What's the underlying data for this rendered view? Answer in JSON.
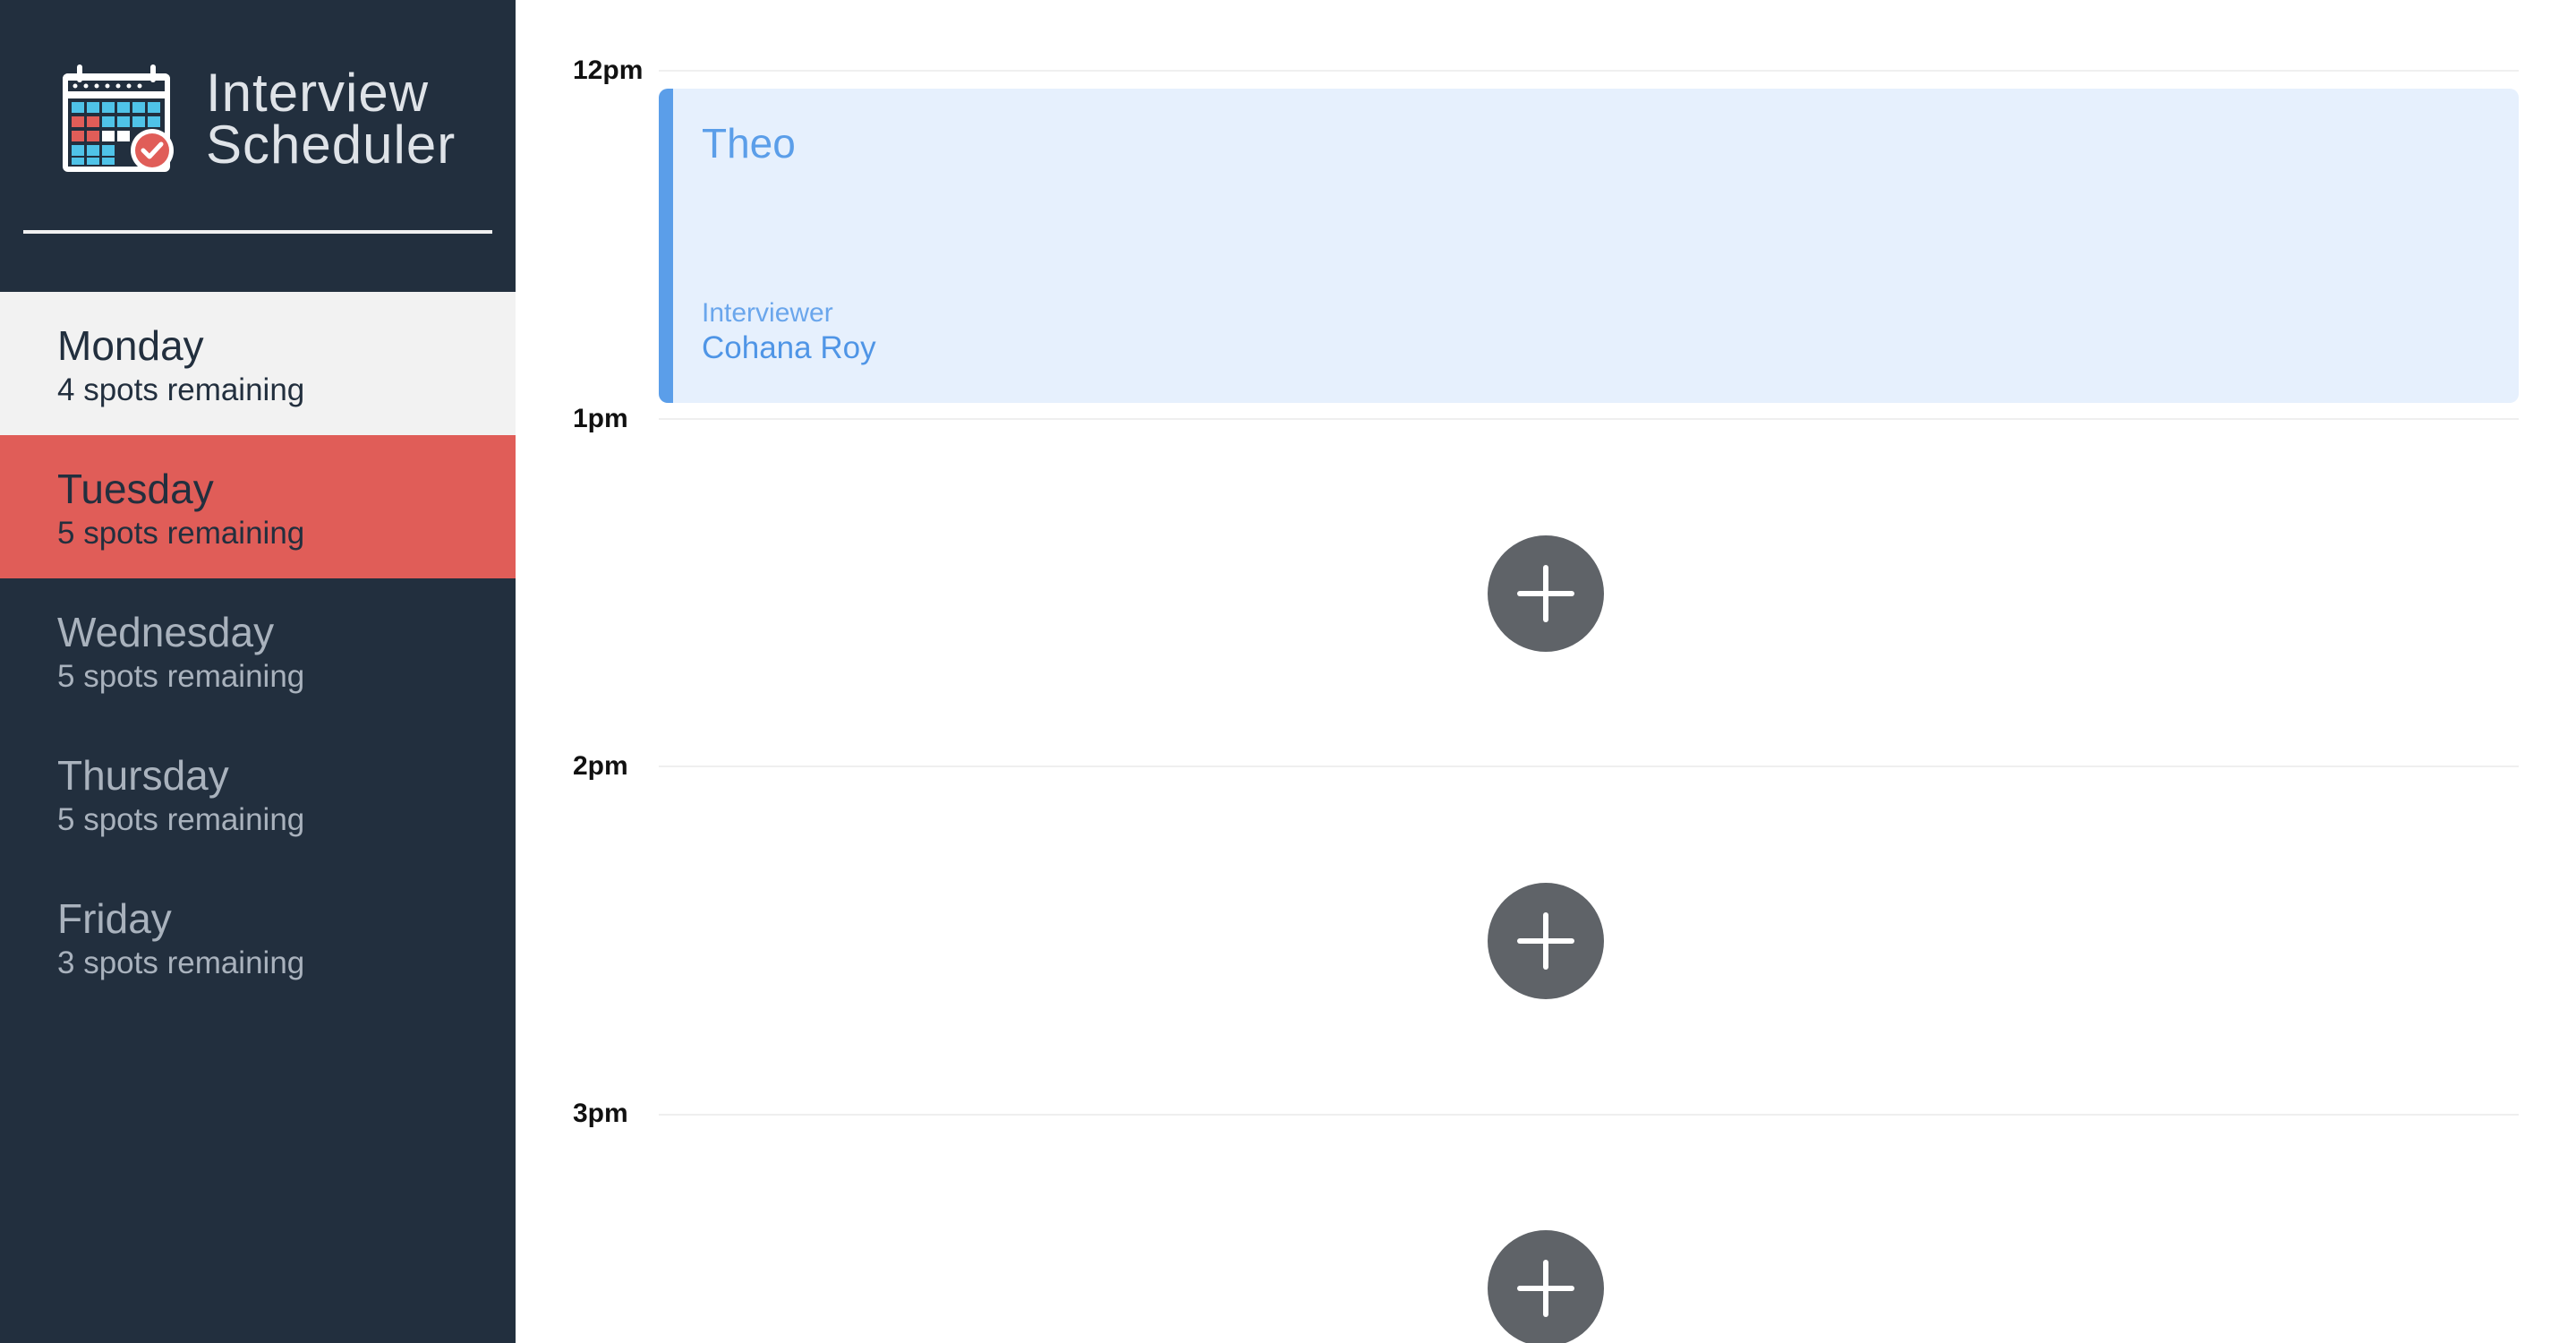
{
  "brand": {
    "title_line1": "Interview",
    "title_line2": "Scheduler",
    "icon": "calendar-check-icon"
  },
  "sidebar": {
    "days": [
      {
        "name": "Monday",
        "spots": "4 spots remaining",
        "state": "selected"
      },
      {
        "name": "Tuesday",
        "spots": "5 spots remaining",
        "state": "highlight"
      },
      {
        "name": "Wednesday",
        "spots": "5 spots remaining",
        "state": "normal"
      },
      {
        "name": "Thursday",
        "spots": "5 spots remaining",
        "state": "normal"
      },
      {
        "name": "Friday",
        "spots": "3 spots remaining",
        "state": "normal"
      }
    ]
  },
  "schedule": {
    "hours": [
      "12pm",
      "1pm",
      "2pm",
      "3pm"
    ],
    "appointment": {
      "student": "Theo",
      "interviewer_caption": "Interviewer",
      "interviewer_name": "Cohana Roy"
    },
    "add_icon": "plus-icon"
  },
  "colors": {
    "sidebar_bg": "#222f3e",
    "selected_day_bg": "#f2f2f2",
    "highlight_day_bg": "#e05d58",
    "appointment_bg": "#e6f0fd",
    "appointment_accent": "#5b9ee9",
    "add_button_bg": "#5f6368"
  }
}
